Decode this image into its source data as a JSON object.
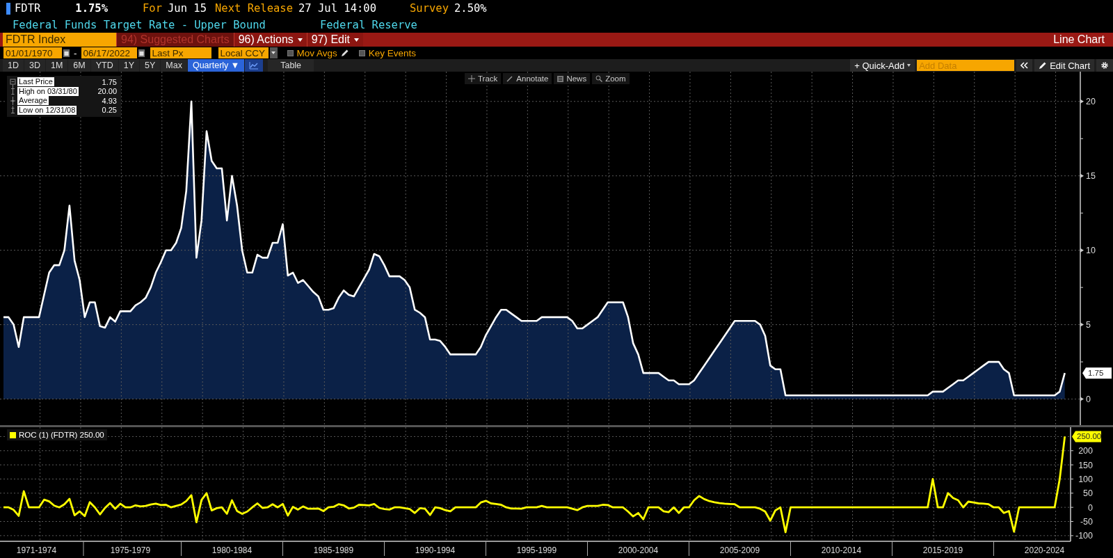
{
  "header": {
    "ticker": "FDTR",
    "price": "1.75%",
    "for_label": "For",
    "for_date": "Jun 15",
    "release_label": "Next Release",
    "release": "27 Jul 14:00",
    "survey_label": "Survey",
    "survey": "2.50%",
    "description": "Federal Funds Target Rate - Upper Bound",
    "source": "Federal Reserve"
  },
  "command_bar": {
    "security": "FDTR Index",
    "menus": [
      {
        "label": "94) Suggested Charts",
        "disabled": true,
        "dropdown": false
      },
      {
        "label": "96) Actions",
        "disabled": false,
        "dropdown": true
      },
      {
        "label": "97) Edit",
        "disabled": false,
        "dropdown": true
      }
    ],
    "title": "Line Chart"
  },
  "range": {
    "start": "01/01/1970",
    "separator": "-",
    "end": "06/17/2022",
    "field": "Last Px",
    "currency": "Local CCY",
    "options": [
      {
        "label": "Mov Avgs",
        "checked": false,
        "editable": true
      },
      {
        "label": "Key Events",
        "checked": false,
        "editable": false
      }
    ]
  },
  "periods": [
    {
      "label": "1D",
      "selected": false
    },
    {
      "label": "3D",
      "selected": false
    },
    {
      "label": "1M",
      "selected": false
    },
    {
      "label": "6M",
      "selected": false
    },
    {
      "label": "YTD",
      "selected": false
    },
    {
      "label": "1Y",
      "selected": false
    },
    {
      "label": "5Y",
      "selected": false
    },
    {
      "label": "Max",
      "selected": false
    },
    {
      "label": "Quarterly ▼",
      "selected": true
    }
  ],
  "views": [
    {
      "kind": "chart",
      "selected": true
    },
    {
      "kind": "table",
      "label": "Table",
      "selected": false
    }
  ],
  "toolbar_right": {
    "quick_add": "+ Quick-Add",
    "add_data_placeholder": "Add Data",
    "edit_chart": "Edit Chart"
  },
  "chart_tools": [
    {
      "kind": "track",
      "label": "Track"
    },
    {
      "kind": "annotate",
      "label": "Annotate"
    },
    {
      "kind": "news",
      "label": "News"
    },
    {
      "kind": "zoom",
      "label": "Zoom"
    }
  ],
  "legend": [
    {
      "kind": "last",
      "value": "1.75"
    },
    {
      "kind": "high",
      "label": "High on 03/31/80",
      "value": "20.00"
    },
    {
      "kind": "average",
      "label": "Average",
      "value": "4.93"
    },
    {
      "kind": "low",
      "label": "Low on 12/31/08",
      "value": "0.25"
    }
  ],
  "price_chart": {
    "last_tag": "1.75",
    "chart_data": {
      "type": "area",
      "grid": true,
      "ylim": [
        -1.75,
        22
      ],
      "yticks": [
        0,
        5,
        10,
        15,
        20
      ],
      "series": [
        {
          "name": "Last Price",
          "color": "#ffffff",
          "values": [
            5.5,
            5.5,
            5.0,
            3.5,
            5.5,
            5.5,
            5.5,
            5.5,
            7.0,
            8.5,
            9.0,
            9.0,
            10,
            13,
            9.3,
            8.0,
            5.5,
            6.5,
            6.5,
            4.9,
            4.8,
            5.5,
            5.2,
            5.9,
            5.9,
            5.9,
            6.3,
            6.5,
            6.8,
            7.5,
            8.5,
            9.2,
            10,
            10,
            10.5,
            11.5,
            14,
            20,
            9.5,
            12,
            18,
            16,
            15.5,
            15.5,
            12,
            15,
            13,
            10,
            8.5,
            8.5,
            9.7,
            9.5,
            9.5,
            10.5,
            10.5,
            11.75,
            8.3,
            8.5,
            7.8,
            8.0,
            7.6,
            7.2,
            6.9,
            6.0,
            6.0,
            6.1,
            6.8,
            7.3,
            7.0,
            6.9,
            7.5,
            8.1,
            8.7,
            9.75,
            9.6,
            9.0,
            8.25,
            8.25,
            8.25,
            8.0,
            7.5,
            6.0,
            5.8,
            5.5,
            4.0,
            4.0,
            3.9,
            3.5,
            3.0,
            3.0,
            3.0,
            3.0,
            3.0,
            3.0,
            3.5,
            4.3,
            4.9,
            5.5,
            6.0,
            6.0,
            5.75,
            5.5,
            5.25,
            5.25,
            5.25,
            5.25,
            5.5,
            5.5,
            5.5,
            5.5,
            5.5,
            5.5,
            5.25,
            4.75,
            4.75,
            5.0,
            5.25,
            5.5,
            6.0,
            6.5,
            6.5,
            6.5,
            6.5,
            5.5,
            3.75,
            3.0,
            1.75,
            1.75,
            1.75,
            1.75,
            1.5,
            1.25,
            1.25,
            1.0,
            1.0,
            1.0,
            1.25,
            1.75,
            2.25,
            2.75,
            3.25,
            3.75,
            4.25,
            4.75,
            5.25,
            5.25,
            5.25,
            5.25,
            5.25,
            5.0,
            4.25,
            2.25,
            2.0,
            2.0,
            0.25,
            0.25,
            0.25,
            0.25,
            0.25,
            0.25,
            0.25,
            0.25,
            0.25,
            0.25,
            0.25,
            0.25,
            0.25,
            0.25,
            0.25,
            0.25,
            0.25,
            0.25,
            0.25,
            0.25,
            0.25,
            0.25,
            0.25,
            0.25,
            0.25,
            0.25,
            0.25,
            0.25,
            0.25,
            0.5,
            0.5,
            0.5,
            0.75,
            1.0,
            1.25,
            1.25,
            1.5,
            1.75,
            2.0,
            2.25,
            2.5,
            2.5,
            2.5,
            2.0,
            1.75,
            0.25,
            0.25,
            0.25,
            0.25,
            0.25,
            0.25,
            0.25,
            0.25,
            0.25,
            0.5,
            1.75
          ]
        }
      ]
    }
  },
  "roc_panel": {
    "legend_value": "250.00",
    "last_tag": "250.00",
    "period_labels": [
      "1971-1974",
      "1975-1979",
      "1980-1984",
      "1985-1989",
      "1990-1994",
      "1995-1999",
      "2000-2004",
      "2005-2009",
      "2010-2014",
      "2015-2019",
      "2020-2024"
    ],
    "chart_data": {
      "type": "line",
      "grid": true,
      "ylim": [
        -120,
        283
      ],
      "yticks": [
        -100,
        -50,
        0,
        50,
        100,
        150,
        200
      ],
      "series": [
        {
          "name": "ROC (1) (FDTR)",
          "color": "#ffff00",
          "values": [
            0,
            0,
            -9,
            -30,
            57,
            0,
            0,
            0,
            27,
            21,
            6,
            0,
            11,
            30,
            -28,
            -14,
            -31,
            18,
            0,
            -25,
            -2,
            15,
            -5,
            13,
            0,
            0,
            7,
            3,
            5,
            10,
            13,
            8,
            9,
            0,
            5,
            10,
            22,
            43,
            -53,
            26,
            50,
            -11,
            -3,
            0,
            -23,
            25,
            -13,
            -23,
            -15,
            0,
            14,
            -2,
            0,
            11,
            0,
            12,
            -29,
            2,
            -8,
            3,
            -5,
            -5,
            -4,
            -13,
            0,
            2,
            11,
            7,
            -4,
            -1,
            9,
            8,
            7,
            12,
            -2,
            -6,
            -8,
            0,
            0,
            -3,
            -6,
            -20,
            -3,
            -5,
            -27,
            0,
            -3,
            -10,
            -14,
            0,
            0,
            0,
            0,
            0,
            17,
            23,
            14,
            12,
            9,
            0,
            -4,
            -4,
            -5,
            0,
            0,
            0,
            5,
            0,
            0,
            0,
            0,
            0,
            -5,
            -10,
            0,
            5,
            5,
            5,
            9,
            8,
            0,
            0,
            0,
            -15,
            -32,
            -20,
            -42,
            0,
            0,
            0,
            -14,
            -17,
            0,
            -20,
            0,
            0,
            25,
            40,
            29,
            22,
            18,
            15,
            13,
            12,
            11,
            0,
            0,
            0,
            0,
            -5,
            -15,
            -47,
            -11,
            0,
            -88,
            0,
            0,
            0,
            0,
            0,
            0,
            0,
            0,
            0,
            0,
            0,
            0,
            0,
            0,
            0,
            0,
            0,
            0,
            0,
            0,
            0,
            0,
            0,
            0,
            0,
            0,
            0,
            0,
            100,
            0,
            0,
            50,
            33,
            25,
            0,
            20,
            17,
            14,
            13,
            11,
            0,
            0,
            -20,
            -13,
            -86,
            0,
            0,
            0,
            0,
            0,
            0,
            0,
            0,
            100,
            250
          ]
        }
      ]
    }
  }
}
